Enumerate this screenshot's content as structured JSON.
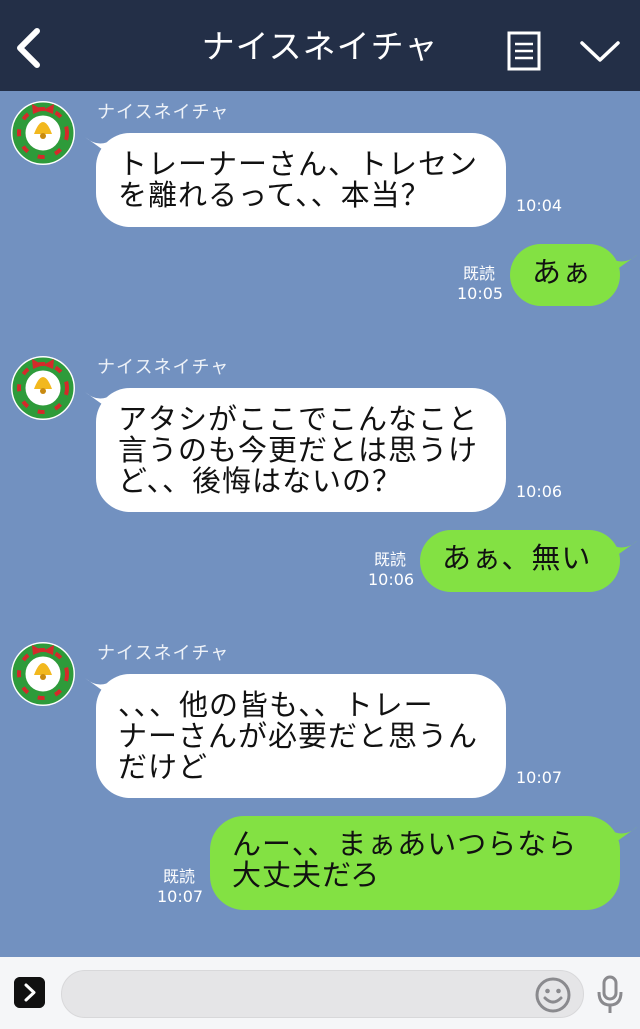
{
  "header": {
    "title": "ナイスネイチャ",
    "icons": [
      "back-chevron-icon",
      "menu-icon",
      "chevron-down-icon"
    ],
    "background": "#232f47"
  },
  "chat": {
    "background": "#7291c0",
    "incoming_bubble_color": "#ffffff",
    "outgoing_bubble_color": "#83e143",
    "messages": [
      {
        "direction": "in",
        "sender": "ナイスネイチャ",
        "lines": [
          "トレーナーさん、トレセン",
          "を離れるって、、本当？"
        ],
        "time": "10:04"
      },
      {
        "direction": "out",
        "lines": [
          "あぁ"
        ],
        "read": "既読",
        "time": "10:05"
      },
      {
        "direction": "in",
        "sender": "ナイスネイチャ",
        "lines": [
          "アタシがここでこんなこと",
          "言うのも今更だとは思うけ",
          "ど、、後悔はないの？"
        ],
        "time": "10:06"
      },
      {
        "direction": "out",
        "lines": [
          "あぁ、無い"
        ],
        "read": "既読",
        "time": "10:06"
      },
      {
        "direction": "in",
        "sender": "ナイスネイチャ",
        "lines": [
          "、、、他の皆も、、トレー",
          "ナーさんが必要だと思うん",
          "だけど"
        ],
        "time": "10:07"
      },
      {
        "direction": "out",
        "lines": [
          "んー、、まぁあいつらなら",
          "大丈夫だろ"
        ],
        "read": "既読",
        "time": "10:07"
      }
    ]
  },
  "input_bar": {
    "message_value": "",
    "icons": [
      "expand-arrow-icon",
      "emoji-icon",
      "microphone-icon"
    ]
  }
}
